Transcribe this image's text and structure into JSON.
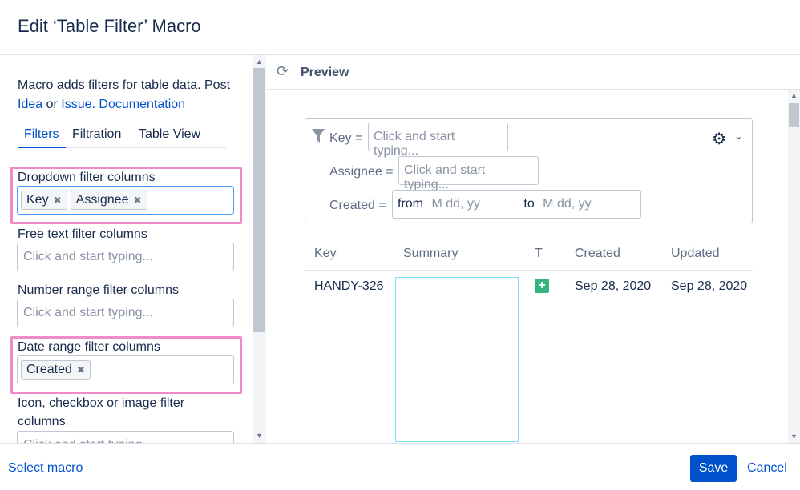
{
  "dialog": {
    "title": "Edit ‘Table Filter’ Macro"
  },
  "description": {
    "text": "Macro adds filters for table data. Post",
    "link_idea": "Idea",
    "or": "or",
    "link_issue": "Issue.",
    "link_docs": "Documentation"
  },
  "tabs": [
    {
      "label": "Filters",
      "active": true
    },
    {
      "label": "Filtration",
      "active": false
    },
    {
      "label": "Table View",
      "active": false
    }
  ],
  "fields": {
    "dropdown": {
      "label": "Dropdown filter columns",
      "chips": [
        "Key",
        "Assignee"
      ]
    },
    "free_text": {
      "label": "Free text filter columns",
      "placeholder": "Click and start typing..."
    },
    "number_range": {
      "label": "Number range filter columns",
      "placeholder": "Click and start typing..."
    },
    "date_range": {
      "label": "Date range filter columns",
      "chips": [
        "Created"
      ]
    },
    "icon_filter": {
      "label_line1": "Icon, checkbox or image filter",
      "label_line2": "columns",
      "placeholder": "Click and start typing..."
    }
  },
  "preview": {
    "title": "Preview",
    "filters": {
      "key_label": "Key =",
      "key_placeholder": "Click and start typing...",
      "assignee_label": "Assignee =",
      "assignee_placeholder": "Click and start typing...",
      "created_label": "Created =",
      "from_label": "from",
      "from_placeholder": "M dd, yy",
      "to_label": "to",
      "to_placeholder": "M dd, yy"
    },
    "table": {
      "headers": [
        "Key",
        "Summary",
        "T",
        "Created",
        "Updated"
      ],
      "rows": [
        {
          "key": "HANDY-326",
          "summary": "",
          "type_icon": "plus-square-icon",
          "created": "Sep 28, 2020",
          "updated": "Sep 28, 2020"
        }
      ]
    }
  },
  "footer": {
    "select_macro": "Select macro",
    "save": "Save",
    "cancel": "Cancel"
  },
  "colors": {
    "accent": "#0052cc",
    "highlight": "#f08ac9",
    "type_icon": "#36b37e"
  }
}
